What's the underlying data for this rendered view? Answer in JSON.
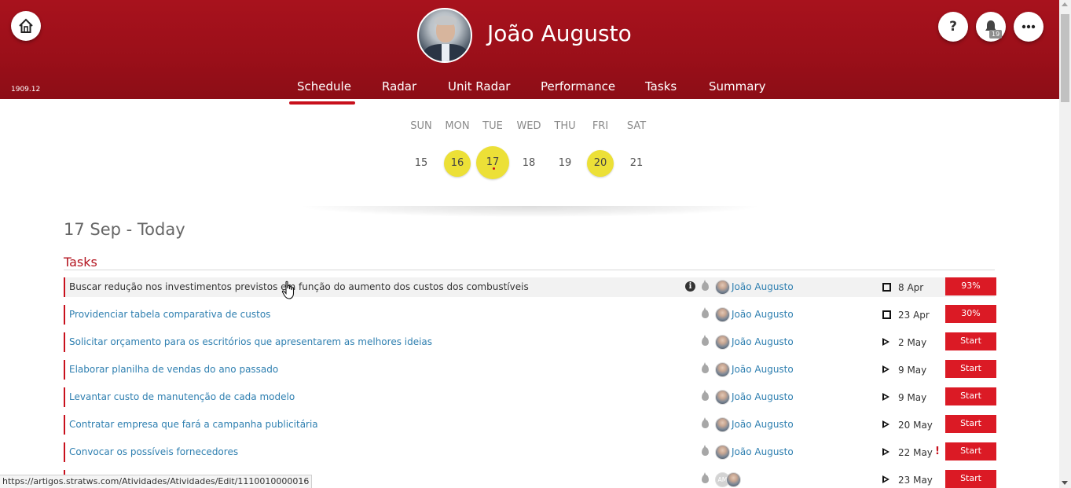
{
  "header": {
    "user_name": "João Augusto",
    "version": "1909.12",
    "help_label": "?",
    "notification_count": "19",
    "brand_color": "#9d101a"
  },
  "nav": {
    "tabs": [
      {
        "label": "Schedule",
        "active": true
      },
      {
        "label": "Radar"
      },
      {
        "label": "Unit Radar"
      },
      {
        "label": "Performance"
      },
      {
        "label": "Tasks"
      },
      {
        "label": "Summary"
      }
    ]
  },
  "calendar": {
    "days": [
      {
        "dow": "SUN",
        "day": "15",
        "highlight": false
      },
      {
        "dow": "MON",
        "day": "16",
        "highlight": true
      },
      {
        "dow": "TUE",
        "day": "17",
        "highlight": true,
        "today": true
      },
      {
        "dow": "WED",
        "day": "18",
        "highlight": false
      },
      {
        "dow": "THU",
        "day": "19",
        "highlight": false
      },
      {
        "dow": "FRI",
        "day": "20",
        "highlight": true
      },
      {
        "dow": "SAT",
        "day": "21",
        "highlight": false
      }
    ],
    "highlight_color": "#ece037"
  },
  "main": {
    "date_heading": "17 Sep - Today",
    "section_title": "Tasks",
    "tasks": [
      {
        "title": "Buscar redução nos investimentos previstos em função do aumento dos custos dos combustíveis",
        "owner": "João Augusto",
        "status_icon": "square-icon",
        "due": "8 Apr",
        "action": "93%",
        "info": true
      },
      {
        "title": "Providenciar tabela comparativa de custos",
        "owner": "João Augusto",
        "status_icon": "square-icon",
        "due": "23 Apr",
        "action": "30%"
      },
      {
        "title": "Solicitar orçamento para os escritórios que apresentarem as melhores ideias",
        "owner": "João Augusto",
        "status_icon": "play-icon",
        "due": "2 May",
        "action": "Start"
      },
      {
        "title": "Elaborar planilha de vendas do ano passado",
        "owner": "João Augusto",
        "status_icon": "play-icon",
        "due": "9 May",
        "action": "Start"
      },
      {
        "title": "Levantar custo de manutenção de cada modelo",
        "owner": "João Augusto",
        "status_icon": "play-icon",
        "due": "9 May",
        "action": "Start"
      },
      {
        "title": "Contratar empresa que fará a campanha publicitária",
        "owner": "João Augusto",
        "status_icon": "play-icon",
        "due": "20 May",
        "action": "Start"
      },
      {
        "title": "Convocar os possíveis fornecedores",
        "owner": "João Augusto",
        "status_icon": "play-icon",
        "due": "22 May",
        "action": "Start",
        "alert": "!"
      },
      {
        "title": "",
        "owner": "",
        "avatar_initials": "AM",
        "status_icon": "play-icon",
        "due": "23 May",
        "action": "Start"
      }
    ]
  },
  "status_bar": {
    "url": "https://artigos.stratws.com/Atividades/Atividades/Edit/1110010000016"
  }
}
